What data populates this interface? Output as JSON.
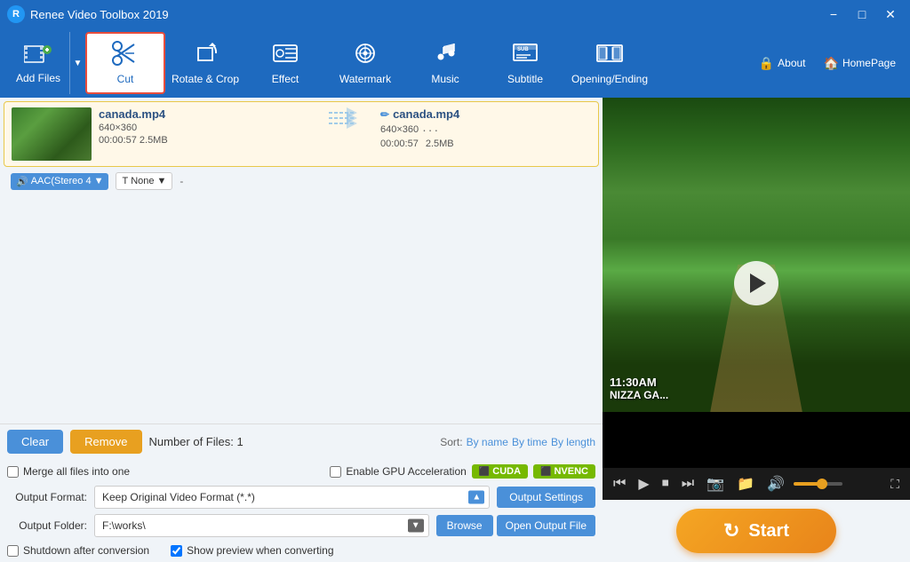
{
  "titleBar": {
    "appName": "Renee Video Toolbox 2019",
    "controls": {
      "minimize": "−",
      "maximize": "□",
      "close": "✕"
    }
  },
  "toolbar": {
    "addFiles": {
      "label": "Add Files",
      "icon": "+"
    },
    "cut": {
      "label": "Cut",
      "icon": "✂",
      "active": true
    },
    "rotateCrop": {
      "label": "Rotate & Crop",
      "icon": "⟳"
    },
    "effect": {
      "label": "Effect",
      "icon": "✦"
    },
    "watermark": {
      "label": "Watermark",
      "icon": "◎"
    },
    "music": {
      "label": "Music",
      "icon": "♪"
    },
    "subtitle": {
      "label": "Subtitle",
      "icon": "≡"
    },
    "openingEnding": {
      "label": "Opening/Ending",
      "icon": "▦"
    },
    "about": {
      "label": "About",
      "icon": "🔒"
    },
    "homePage": {
      "label": "HomePage",
      "icon": "🏠"
    }
  },
  "fileList": {
    "items": [
      {
        "thumbnail": "tree-path",
        "name": "canada.mp4",
        "resolution": "640×360",
        "duration": "00:00:57",
        "size": "2.5MB",
        "outputName": "canada.mp4",
        "outputResolution": "640×360",
        "outputDuration": "00:00:57",
        "outputSize": "2.5MB",
        "audioTrack": "AAC(Stereo 4",
        "subtitle": "None",
        "extra": "-"
      }
    ]
  },
  "controls": {
    "clearLabel": "Clear",
    "removeLabel": "Remove",
    "fileCount": "Number of Files:  1",
    "sortLabel": "Sort:",
    "sortOptions": [
      "By name",
      "By time",
      "By length"
    ]
  },
  "options": {
    "mergeLabel": "Merge all files into one",
    "gpuLabel": "Enable GPU Acceleration",
    "cudaLabel": "CUDA",
    "nvencLabel": "NVENC"
  },
  "output": {
    "formatLabel": "Output Format:",
    "formatValue": "Keep Original Video Format (*.*)",
    "outputSettingsLabel": "Output Settings",
    "folderLabel": "Output Folder:",
    "folderValue": "F:\\works\\",
    "browseLabel": "Browse",
    "openOutputLabel": "Open Output File",
    "shutdownLabel": "Shutdown after conversion",
    "showPreviewLabel": "Show preview when converting"
  },
  "startButton": {
    "label": "Start",
    "icon": "↻"
  },
  "videoPreview": {
    "timeOverlay": "11:30AM",
    "locationOverlay": "NIZZA GA..."
  }
}
